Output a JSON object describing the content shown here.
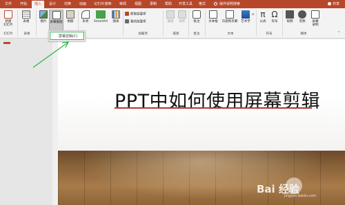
{
  "tabs": [
    "文件",
    "开始",
    "插入",
    "设计",
    "切换",
    "动画",
    "幻灯片放映",
    "审阅",
    "视图",
    "录制",
    "帮助",
    "开发工具",
    "格式"
  ],
  "tell_me": "操作说明搜索",
  "share": "共享",
  "ribbon": {
    "new_slide": "新建\n幻灯片",
    "table": "表格",
    "picture": "图片",
    "screenshot": "屏幕截图",
    "album": "相册",
    "shapes": "形状",
    "smartart": "SmartArt",
    "chart": "图表",
    "get_addins": "获取加载项",
    "my_addins": "我的加载项",
    "link": "链接",
    "action": "动作",
    "comment": "批注",
    "textbox": "文本框",
    "header_footer": "页眉和页脚",
    "wordart": "艺术字",
    "equation": "公式",
    "symbol": "符号",
    "video": "视频",
    "audio": "音频",
    "screen_recording": "屏幕\n录制",
    "groups": {
      "slides": "幻灯片",
      "tables": "表格",
      "images": "图像",
      "addins": "加载项",
      "links": "链接",
      "comments": "批注",
      "text": "文本",
      "symbols": "符号",
      "media": "媒体"
    }
  },
  "dropdown": {
    "item": "屏幕剪辑(C)"
  },
  "slide": {
    "title": "PPT中如何使用屏幕剪辑"
  },
  "watermark": {
    "text": "Bai 经验",
    "sub": "jingyan.baidu.com"
  },
  "colors": {
    "accent": "#b7472a",
    "annotation": "#2db34a",
    "title_underline": "#b3353a"
  }
}
